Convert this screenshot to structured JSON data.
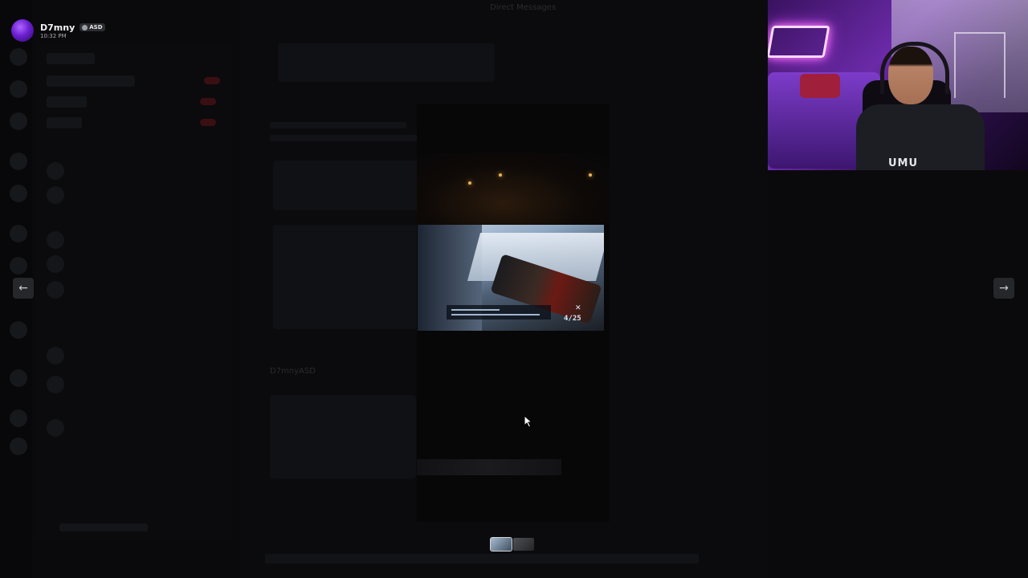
{
  "poster": {
    "name": "D7mny",
    "tag_label": "ASD",
    "timestamp": "10:32 PM"
  },
  "top_bar": {
    "title": "Direct Messages"
  },
  "viewer": {
    "prev_label": "←",
    "next_label": "→",
    "hud_ammo": "4/25",
    "hud_marker": "✕"
  },
  "webcam": {
    "shirt_text": "UMU"
  },
  "background_chat": {
    "message_author": "D7mny",
    "message_tag": "ASD"
  },
  "icons": {
    "prev": "arrow-left-icon",
    "next": "arrow-right-icon",
    "cursor": "mouse-pointer-icon",
    "tag": "skull-icon"
  },
  "colors": {
    "backdrop": "#050506",
    "arrow_bg": "#26272b",
    "avatar_purple": "#6a1fd0",
    "webcam_purple": "#6b2aa8",
    "neon": "#ff7bf2"
  }
}
